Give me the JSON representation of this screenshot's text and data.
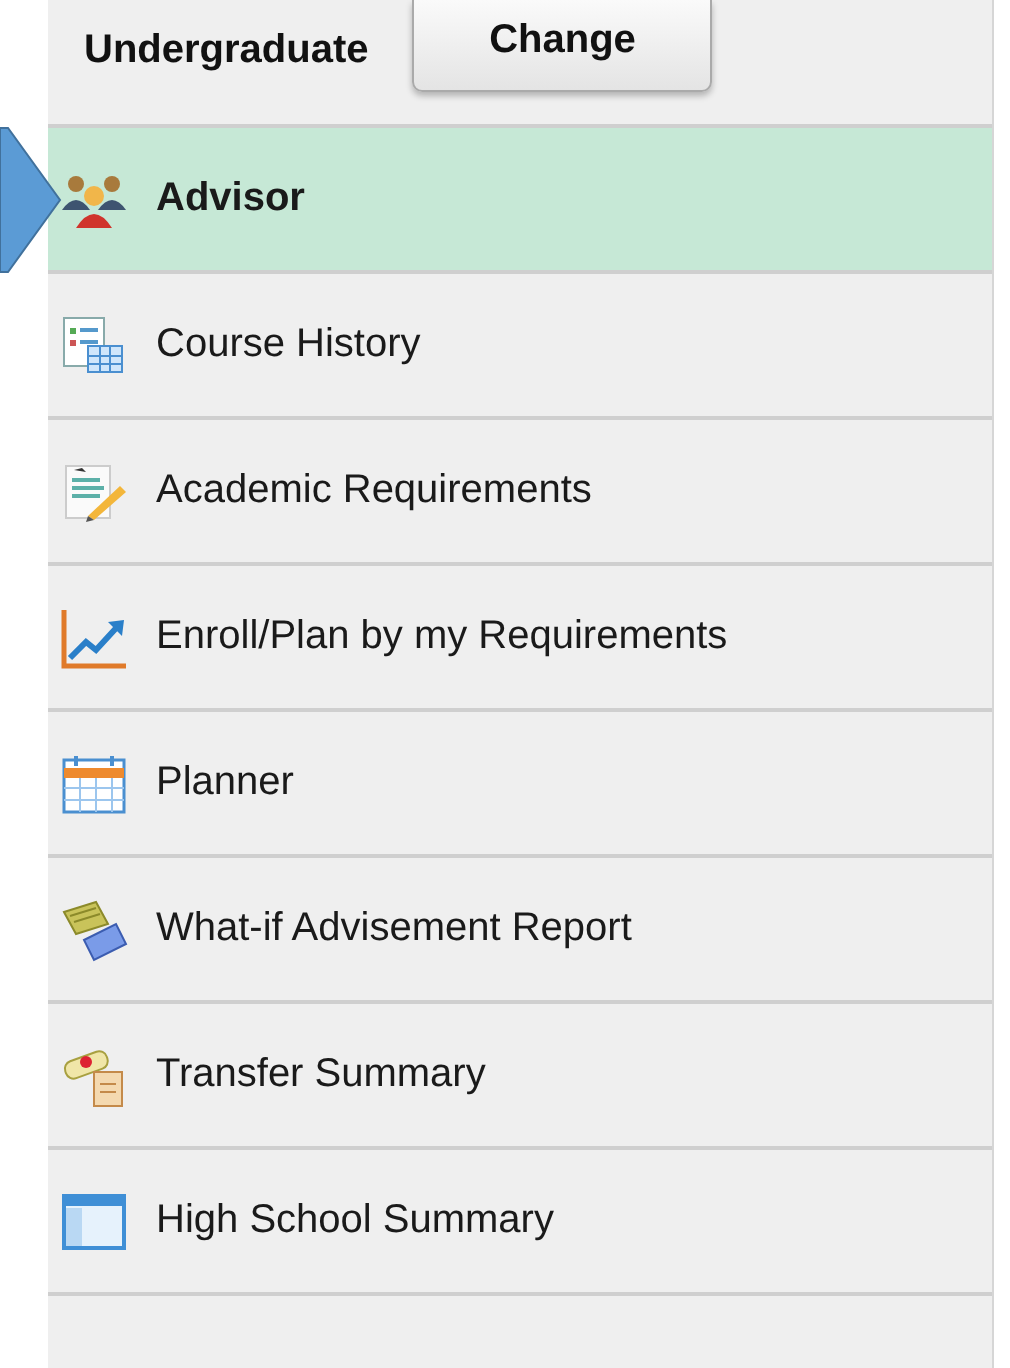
{
  "header": {
    "career": "Undergraduate",
    "button": "Change"
  },
  "menu": [
    {
      "label": "Advisor",
      "kind": "people",
      "selected": true
    },
    {
      "label": "Course History",
      "kind": "list",
      "selected": false
    },
    {
      "label": "Academic Requirements",
      "kind": "doc",
      "selected": false
    },
    {
      "label": "Enroll/Plan by my Requirements",
      "kind": "chart",
      "selected": false
    },
    {
      "label": "Planner",
      "kind": "calendar",
      "selected": false
    },
    {
      "label": "What-if Advisement Report",
      "kind": "money",
      "selected": false
    },
    {
      "label": "Transfer Summary",
      "kind": "diploma",
      "selected": false
    },
    {
      "label": "High School Summary",
      "kind": "window",
      "selected": false
    }
  ]
}
